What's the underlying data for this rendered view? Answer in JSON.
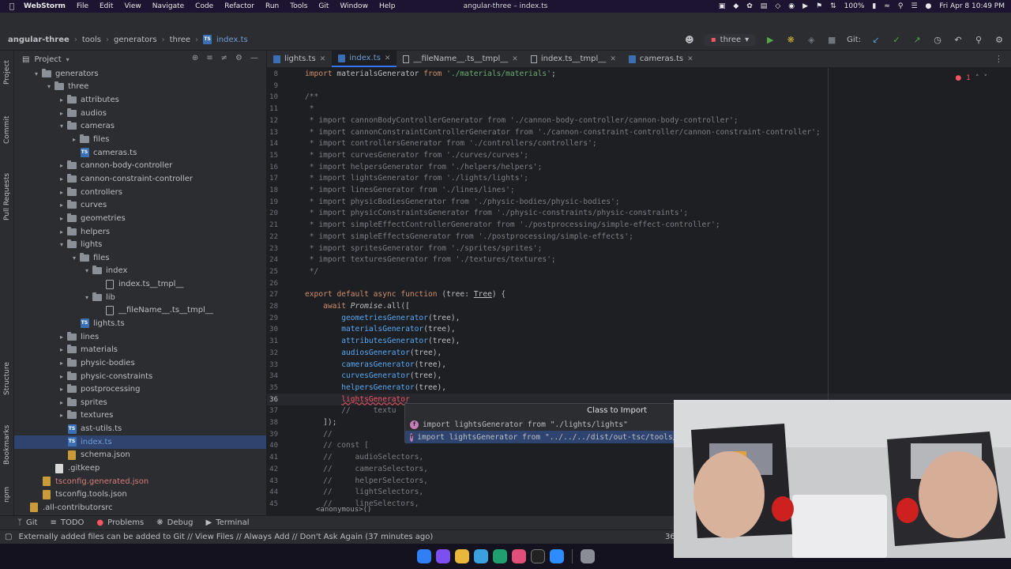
{
  "menubar": {
    "app_name": "WebStorm",
    "menus": [
      "File",
      "Edit",
      "View",
      "Navigate",
      "Code",
      "Refactor",
      "Run",
      "Tools",
      "Git",
      "Window",
      "Help"
    ],
    "window_title": "angular-three – index.ts",
    "battery": "100%",
    "datetime": "Fri Apr 8  10:49 PM"
  },
  "breadcrumb": [
    "angular-three",
    "tools",
    "generators",
    "three",
    "index.ts"
  ],
  "toolbar": {
    "run_config": "three",
    "git_label": "Git:"
  },
  "left_stripe": [
    "Project",
    "Commit",
    "Pull Requests",
    "Structure",
    "Bookmarks",
    "npm"
  ],
  "project_panel": {
    "title": "Project",
    "tree": [
      {
        "label": "generators",
        "depth": 2,
        "type": "folder",
        "open": true
      },
      {
        "label": "three",
        "depth": 3,
        "type": "folder",
        "open": true
      },
      {
        "label": "attributes",
        "depth": 4,
        "type": "folder",
        "open": false
      },
      {
        "label": "audios",
        "depth": 4,
        "type": "folder",
        "open": false
      },
      {
        "label": "cameras",
        "depth": 4,
        "type": "folder",
        "open": true
      },
      {
        "label": "files",
        "depth": 5,
        "type": "folder",
        "open": false
      },
      {
        "label": "cameras.ts",
        "depth": 5,
        "type": "ts"
      },
      {
        "label": "cannon-body-controller",
        "depth": 4,
        "type": "folder",
        "open": false
      },
      {
        "label": "cannon-constraint-controller",
        "depth": 4,
        "type": "folder",
        "open": false
      },
      {
        "label": "controllers",
        "depth": 4,
        "type": "folder",
        "open": false
      },
      {
        "label": "curves",
        "depth": 4,
        "type": "folder",
        "open": false
      },
      {
        "label": "geometries",
        "depth": 4,
        "type": "folder",
        "open": false
      },
      {
        "label": "helpers",
        "depth": 4,
        "type": "folder",
        "open": false
      },
      {
        "label": "lights",
        "depth": 4,
        "type": "folder",
        "open": true
      },
      {
        "label": "files",
        "depth": 5,
        "type": "folder",
        "open": true
      },
      {
        "label": "index",
        "depth": 6,
        "type": "folder",
        "open": true
      },
      {
        "label": "index.ts__tmpl__",
        "depth": 7,
        "type": "tmpl"
      },
      {
        "label": "lib",
        "depth": 6,
        "type": "folder",
        "open": true
      },
      {
        "label": "__fileName__.ts__tmpl__",
        "depth": 7,
        "type": "tmpl"
      },
      {
        "label": "lights.ts",
        "depth": 5,
        "type": "ts"
      },
      {
        "label": "lines",
        "depth": 4,
        "type": "folder",
        "open": false
      },
      {
        "label": "materials",
        "depth": 4,
        "type": "folder",
        "open": false
      },
      {
        "label": "physic-bodies",
        "depth": 4,
        "type": "folder",
        "open": false
      },
      {
        "label": "physic-constraints",
        "depth": 4,
        "type": "folder",
        "open": false
      },
      {
        "label": "postprocessing",
        "depth": 4,
        "type": "folder",
        "open": false
      },
      {
        "label": "sprites",
        "depth": 4,
        "type": "folder",
        "open": false
      },
      {
        "label": "textures",
        "depth": 4,
        "type": "folder",
        "open": false
      },
      {
        "label": "ast-utils.ts",
        "depth": 4,
        "type": "ts"
      },
      {
        "label": "index.ts",
        "depth": 4,
        "type": "ts",
        "selected": true
      },
      {
        "label": "schema.json",
        "depth": 4,
        "type": "json"
      },
      {
        "label": ".gitkeep",
        "depth": 3,
        "type": "plain"
      },
      {
        "label": "tsconfig.generated.json",
        "depth": 2,
        "type": "json",
        "modified": true
      },
      {
        "label": "tsconfig.tools.json",
        "depth": 2,
        "type": "json"
      },
      {
        "label": ".all-contributorsrc",
        "depth": 1,
        "type": "json"
      }
    ]
  },
  "editor_tabs": [
    {
      "label": "lights.ts",
      "kind": "ts"
    },
    {
      "label": "index.ts",
      "kind": "ts",
      "active": true
    },
    {
      "label": "__fileName__.ts__tmpl__",
      "kind": "tmpl"
    },
    {
      "label": "index.ts__tmpl__",
      "kind": "tmpl"
    },
    {
      "label": "cameras.ts",
      "kind": "ts"
    }
  ],
  "editor": {
    "error_count": "1",
    "line_numbers": [
      "8",
      "9",
      "10",
      "11",
      "12",
      "13",
      "14",
      "15",
      "16",
      "17",
      "18",
      "19",
      "20",
      "21",
      "22",
      "23",
      "24",
      "25",
      "26",
      "27",
      "28",
      "29",
      "30",
      "31",
      "32",
      "33",
      "34",
      "35",
      "36",
      "37",
      "38",
      "39",
      "40",
      "41",
      "42",
      "43",
      "44",
      "45"
    ],
    "current_line": "36",
    "lines": [
      "import materialsGenerator from './materials/materials';",
      "",
      "/**",
      " *",
      " * import cannonBodyControllerGenerator from './cannon-body-controller/cannon-body-controller';",
      " * import cannonConstraintControllerGenerator from './cannon-constraint-controller/cannon-constraint-controller';",
      " * import controllersGenerator from './controllers/controllers';",
      " * import curvesGenerator from './curves/curves';",
      " * import helpersGenerator from './helpers/helpers';",
      " * import lightsGenerator from './lights/lights';",
      " * import linesGenerator from './lines/lines';",
      " * import physicBodiesGenerator from './physic-bodies/physic-bodies';",
      " * import physicConstraintsGenerator from './physic-constraints/physic-constraints';",
      " * import simpleEffectControllerGenerator from './postprocessing/simple-effect-controller';",
      " * import simpleEffectsGenerator from './postprocessing/simple-effects';",
      " * import spritesGenerator from './sprites/sprites';",
      " * import texturesGenerator from './textures/textures';",
      " */",
      "",
      "export default async function (tree: Tree) {",
      "    await Promise.all([",
      "        geometriesGenerator(tree),",
      "        materialsGenerator(tree),",
      "        attributesGenerator(tree),",
      "        audiosGenerator(tree),",
      "        camerasGenerator(tree),",
      "        curvesGenerator(tree),",
      "        helpersGenerator(tree),",
      "        lightsGenerator",
      "        //     textu",
      "    ]);",
      "    //",
      "    // const [",
      "    //     audioSelectors,",
      "    //     cameraSelectors,",
      "    //     helperSelectors,",
      "    //     lightSelectors,",
      "    //     lineSelectors,"
    ]
  },
  "completion": {
    "header": "Class to Import",
    "items": [
      "import lightsGenerator from \"./lights/lights\"",
      "import lightsGenerator from \"../../../dist/out-tsc/tools/g"
    ]
  },
  "anon_crumb": "<anonymous>()",
  "bottom_tools": [
    "Git",
    "TODO",
    "Problems",
    "Debug",
    "Terminal"
  ],
  "status": {
    "message": "Externally added files can be added to Git // View Files // Always Add // Don't Ask Again (37 minutes ago)",
    "position": "36"
  },
  "colors": {
    "accent": "#3574f0",
    "error": "#f75464",
    "keyword": "#cf8e6d",
    "string": "#6aab73",
    "comment": "#7a7e85"
  }
}
